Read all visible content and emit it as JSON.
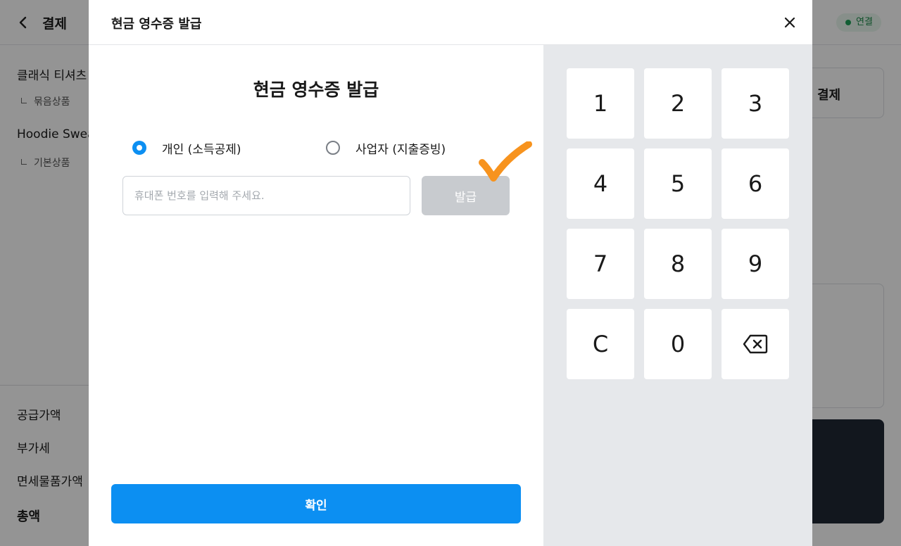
{
  "background": {
    "header": {
      "title": "결제",
      "status": "연결"
    },
    "items": [
      {
        "name": "클래식 티셔츠",
        "sub": "묶음상품"
      },
      {
        "name": "Hoodie Swea",
        "sub": "기본상품"
      }
    ],
    "summary": {
      "supply_label": "공급가액",
      "vat_label": "부가세",
      "taxfree_label": "면세물품가액",
      "total_label": "총액"
    },
    "pay_card_label": "결제"
  },
  "modal": {
    "header_title": "현금 영수증 발급",
    "pane_title": "현금 영수증 발급",
    "radio_options": [
      {
        "label": "개인 (소득공제)",
        "selected": true
      },
      {
        "label": "사업자 (지출증빙)",
        "selected": false
      }
    ],
    "phone_input": {
      "value": "",
      "placeholder": "휴대폰 번호를 입력해 주세요."
    },
    "issue_button": "발급",
    "confirm_button": "확인",
    "keypad": [
      "1",
      "2",
      "3",
      "4",
      "5",
      "6",
      "7",
      "8",
      "9",
      "C",
      "0",
      "backspace-icon"
    ]
  },
  "colors": {
    "accent": "#0c8ff2",
    "disabled_button": "#c8cbcf",
    "keypad_background": "#e6e8eb",
    "annotation_check": "#f7931e",
    "status_green": "#1fa35a"
  }
}
